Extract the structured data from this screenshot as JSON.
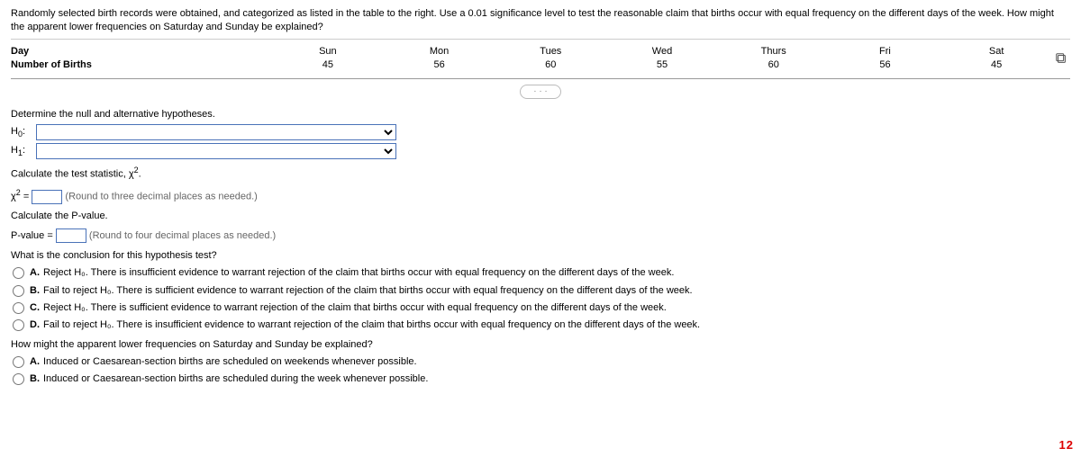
{
  "intro": "Randomly selected birth records were obtained, and categorized as listed in the table to the right. Use a 0.01 significance level to test the reasonable claim that births occur with equal frequency on the different days of the week. How might the apparent lower frequencies on Saturday and Sunday be explained?",
  "table": {
    "row1_label": "Day",
    "row2_label": "Number of Births",
    "cols": [
      {
        "day": "Sun",
        "count": "45"
      },
      {
        "day": "Mon",
        "count": "56"
      },
      {
        "day": "Tues",
        "count": "60"
      },
      {
        "day": "Wed",
        "count": "55"
      },
      {
        "day": "Thurs",
        "count": "60"
      },
      {
        "day": "Fri",
        "count": "56"
      },
      {
        "day": "Sat",
        "count": "45"
      }
    ]
  },
  "dots": "· · ·",
  "q_hypotheses": "Determine the null and alternative hypotheses.",
  "h0_label": "H",
  "h0_sub": "0",
  "h1_label": "H",
  "h1_sub": "1",
  "colon": ":",
  "q_test_stat_a": "Calculate the test statistic, ",
  "chi_sym": "χ",
  "sq": "2",
  "period": ".",
  "chi_eq": " = ",
  "chi_hint": "(Round to three decimal places as needed.)",
  "q_pvalue": "Calculate the P-value.",
  "pvalue_label": "P-value = ",
  "pvalue_hint": "(Round to four decimal places as needed.)",
  "q_conclusion": "What is the conclusion for this hypothesis test?",
  "conclusion_choices": [
    {
      "letter": "A.",
      "text": "Reject H₀. There is insufficient evidence to warrant rejection of the claim that births occur with equal frequency on the different days of the week."
    },
    {
      "letter": "B.",
      "text": "Fail to reject H₀. There is sufficient evidence to warrant rejection of the claim that births occur with equal frequency on the different days of the week."
    },
    {
      "letter": "C.",
      "text": "Reject H₀. There is sufficient evidence to warrant rejection of the claim that births occur with equal frequency on the different days of the week."
    },
    {
      "letter": "D.",
      "text": "Fail to reject H₀. There is insufficient evidence to warrant rejection of the claim that births occur with equal frequency on the different days of the week."
    }
  ],
  "q_explain": "How might the apparent lower frequencies on Saturday and Sunday be explained?",
  "explain_choices": [
    {
      "letter": "A.",
      "text": "Induced or Caesarean-section births are scheduled on weekends whenever possible."
    },
    {
      "letter": "B.",
      "text": "Induced or Caesarean-section births are scheduled during the week whenever possible."
    }
  ],
  "page_number": "12",
  "chart_data": {
    "type": "table",
    "title": "Number of Births by Day of Week",
    "categories": [
      "Sun",
      "Mon",
      "Tues",
      "Wed",
      "Thurs",
      "Fri",
      "Sat"
    ],
    "values": [
      45,
      56,
      60,
      55,
      60,
      56,
      45
    ]
  }
}
